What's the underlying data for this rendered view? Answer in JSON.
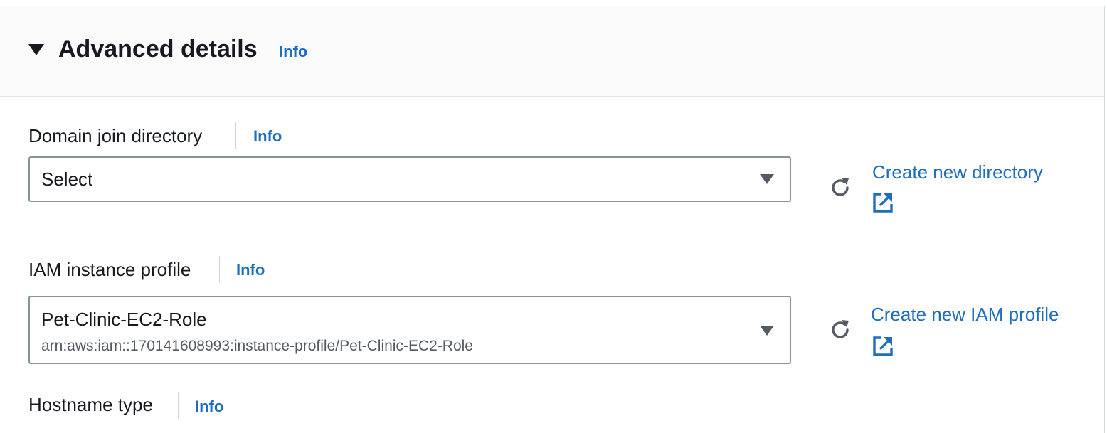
{
  "section": {
    "title": "Advanced details",
    "info_label": "Info"
  },
  "fields": [
    {
      "label": "Domain join directory",
      "info_label": "Info",
      "select": {
        "value": "Select",
        "description": ""
      },
      "create_link": "Create new directory"
    },
    {
      "label": "IAM instance profile",
      "info_label": "Info",
      "select": {
        "value": "Pet-Clinic-EC2-Role",
        "description": "arn:aws:iam::170141608993:instance-profile/Pet-Clinic-EC2-Role"
      },
      "create_link": "Create new IAM profile"
    },
    {
      "label": "Hostname type",
      "info_label": "Info"
    }
  ],
  "icons": {
    "expand": "caret-down-icon",
    "dropdown": "caret-down-icon",
    "refresh": "refresh-icon",
    "external": "external-link-icon"
  },
  "colors": {
    "link": "#1e6dbe",
    "text": "#16191f",
    "secondary_text": "#545b64",
    "header_bg": "#fafafa",
    "border": "#879596"
  }
}
